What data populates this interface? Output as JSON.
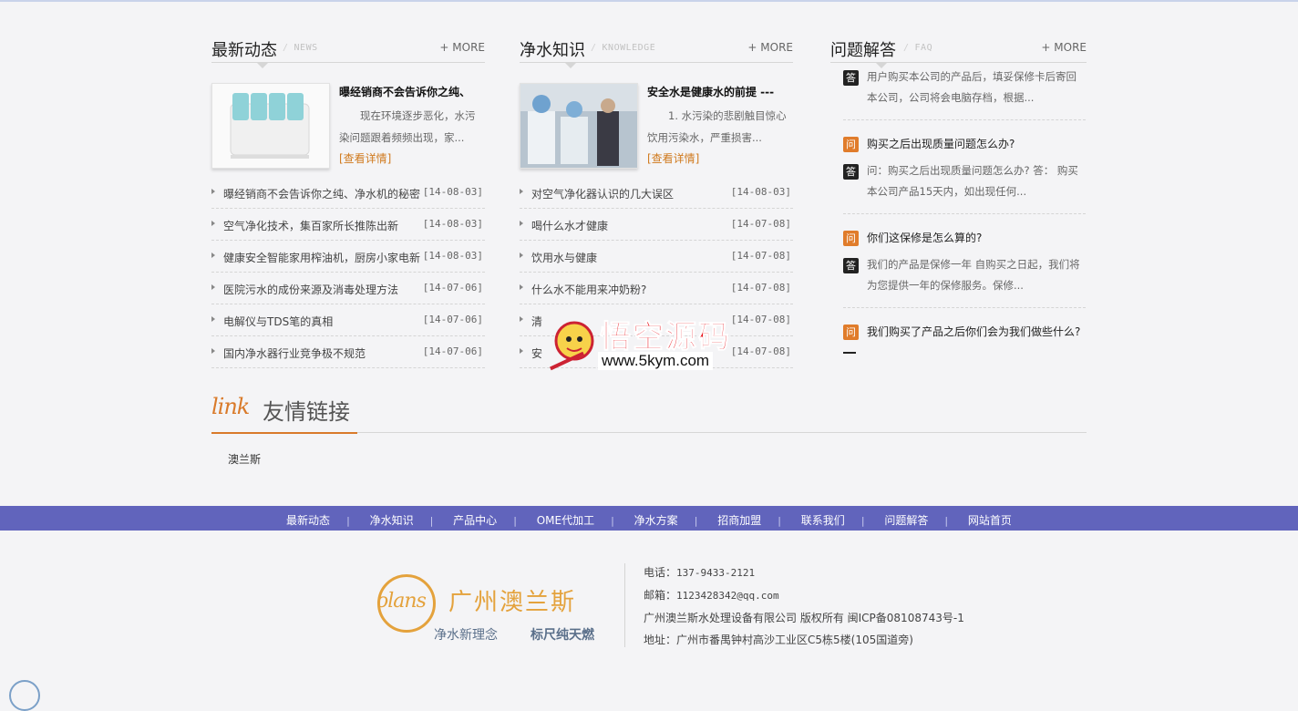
{
  "news": {
    "title": "最新动态",
    "en": "NEWS",
    "more": "+ MORE",
    "feature": {
      "title": "曝经销商不会告诉你之纯、",
      "desc": "现在环境逐步恶化，水污染问题跟着频频出现，家...",
      "detail": "[查看详情]",
      "image_icon": "water-purifier-image"
    },
    "items": [
      {
        "text": "曝经销商不会告诉你之纯、净水机的秘密",
        "date": "[14-08-03]"
      },
      {
        "text": "空气净化技术，集百家所长推陈出新",
        "date": "[14-08-03]"
      },
      {
        "text": "健康安全智能家用榨油机，厨房小家电新",
        "date": "[14-08-03]"
      },
      {
        "text": "医院污水的成份来源及消毒处理方法",
        "date": "[14-07-06]"
      },
      {
        "text": "电解仪与TDS笔的真相",
        "date": "[14-07-06]"
      },
      {
        "text": "国内净水器行业竞争极不规范",
        "date": "[14-07-06]"
      }
    ]
  },
  "knowledge": {
    "title": "净水知识",
    "en": "KNOWLEDGE",
    "more": "+ MORE",
    "feature": {
      "title": "安全水是健康水的前提 ---",
      "desc": "1. 水污染的悲剧触目惊心 饮用污染水，严重损害...",
      "detail": "[查看详情]",
      "image_icon": "water-dispenser-photo"
    },
    "items": [
      {
        "text": "对空气净化器认识的几大误区",
        "date": "[14-08-03]"
      },
      {
        "text": "喝什么水才健康",
        "date": "[14-07-08]"
      },
      {
        "text": "饮用水与健康",
        "date": "[14-07-08]"
      },
      {
        "text": "什么水不能用来冲奶粉?",
        "date": "[14-07-08]"
      },
      {
        "text": "清",
        "date": "[14-07-08]"
      },
      {
        "text": "安",
        "date": "[14-07-08]"
      }
    ]
  },
  "faq": {
    "title": "问题解答",
    "en": "FAQ",
    "more": "+ MORE",
    "q_badge": "问",
    "a_badge": "答",
    "items": [
      {
        "q": "",
        "a": "用户购买本公司的产品后，填妥保修卡后寄回本公司，公司将会电脑存档，根据..."
      },
      {
        "q": "购买之后出现质量问题怎么办?",
        "a": "问：购买之后出现质量问题怎么办? 答： 购买本公司产品15天内，如出现任何..."
      },
      {
        "q": "你们这保修是怎么算的?",
        "a": "我们的产品是保修一年 自购买之日起，我们将为您提供一年的保修服务。保修..."
      },
      {
        "q": "我们购买了产品之后你们会为我们做些什么?",
        "a": ""
      }
    ]
  },
  "links": {
    "script": "link",
    "title": "友情链接",
    "items": [
      "澳兰斯"
    ]
  },
  "nav": [
    "最新动态",
    "净水知识",
    "产品中心",
    "OME代加工",
    "净水方案",
    "招商加盟",
    "联系我们",
    "问题解答",
    "网站首页"
  ],
  "footer": {
    "logo_en": "olans",
    "logo_cn": "广州澳兰斯",
    "slogan1": "净水新理念",
    "slogan2": "标尺纯天燃",
    "phone_label": "电话：",
    "phone": "137-9433-2121",
    "email_label": "邮箱：",
    "email": "1123428342@qq.com",
    "copyright": "广州澳兰斯水处理设备有限公司 版权所有 闽ICP备08108743号-1",
    "address_label": "地址：",
    "address": "广州市番禺钟村高沙工业区C5栋5楼(105国道旁)"
  },
  "watermark": {
    "cn": "悟空源码",
    "url": "www.5kym.com"
  }
}
